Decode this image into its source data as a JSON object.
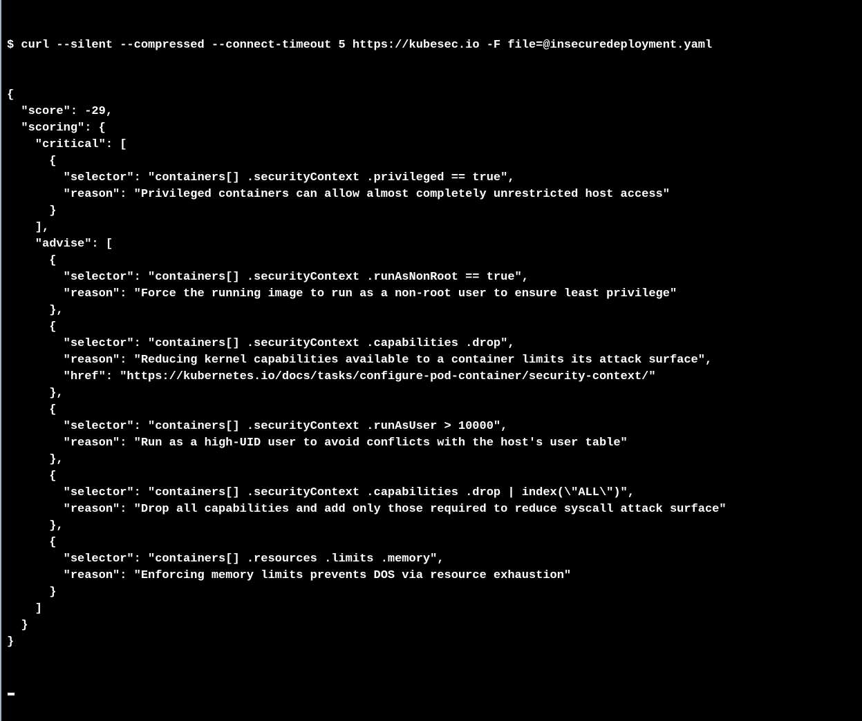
{
  "prompt_symbol": "$ ",
  "command": "curl --silent --compressed --connect-timeout 5 https://kubesec.io -F file=@insecuredeployment.yaml",
  "output_lines": [
    "{",
    "  \"score\": -29,",
    "  \"scoring\": {",
    "    \"critical\": [",
    "      {",
    "        \"selector\": \"containers[] .securityContext .privileged == true\",",
    "        \"reason\": \"Privileged containers can allow almost completely unrestricted host access\"",
    "      }",
    "    ],",
    "    \"advise\": [",
    "      {",
    "        \"selector\": \"containers[] .securityContext .runAsNonRoot == true\",",
    "        \"reason\": \"Force the running image to run as a non-root user to ensure least privilege\"",
    "      },",
    "      {",
    "        \"selector\": \"containers[] .securityContext .capabilities .drop\",",
    "        \"reason\": \"Reducing kernel capabilities available to a container limits its attack surface\",",
    "        \"href\": \"https://kubernetes.io/docs/tasks/configure-pod-container/security-context/\"",
    "      },",
    "      {",
    "        \"selector\": \"containers[] .securityContext .runAsUser > 10000\",",
    "        \"reason\": \"Run as a high-UID user to avoid conflicts with the host's user table\"",
    "      },",
    "      {",
    "        \"selector\": \"containers[] .securityContext .capabilities .drop | index(\\\"ALL\\\")\",",
    "        \"reason\": \"Drop all capabilities and add only those required to reduce syscall attack surface\"",
    "      },",
    "      {",
    "        \"selector\": \"containers[] .resources .limits .memory\",",
    "        \"reason\": \"Enforcing memory limits prevents DOS via resource exhaustion\"",
    "      }",
    "    ]",
    "  }",
    "}"
  ],
  "json_response": {
    "score": -29,
    "scoring": {
      "critical": [
        {
          "selector": "containers[] .securityContext .privileged == true",
          "reason": "Privileged containers can allow almost completely unrestricted host access"
        }
      ],
      "advise": [
        {
          "selector": "containers[] .securityContext .runAsNonRoot == true",
          "reason": "Force the running image to run as a non-root user to ensure least privilege"
        },
        {
          "selector": "containers[] .securityContext .capabilities .drop",
          "reason": "Reducing kernel capabilities available to a container limits its attack surface",
          "href": "https://kubernetes.io/docs/tasks/configure-pod-container/security-context/"
        },
        {
          "selector": "containers[] .securityContext .runAsUser > 10000",
          "reason": "Run as a high-UID user to avoid conflicts with the host's user table"
        },
        {
          "selector": "containers[] .securityContext .capabilities .drop | index(\"ALL\")",
          "reason": "Drop all capabilities and add only those required to reduce syscall attack surface"
        },
        {
          "selector": "containers[] .resources .limits .memory",
          "reason": "Enforcing memory limits prevents DOS via resource exhaustion"
        }
      ]
    }
  }
}
